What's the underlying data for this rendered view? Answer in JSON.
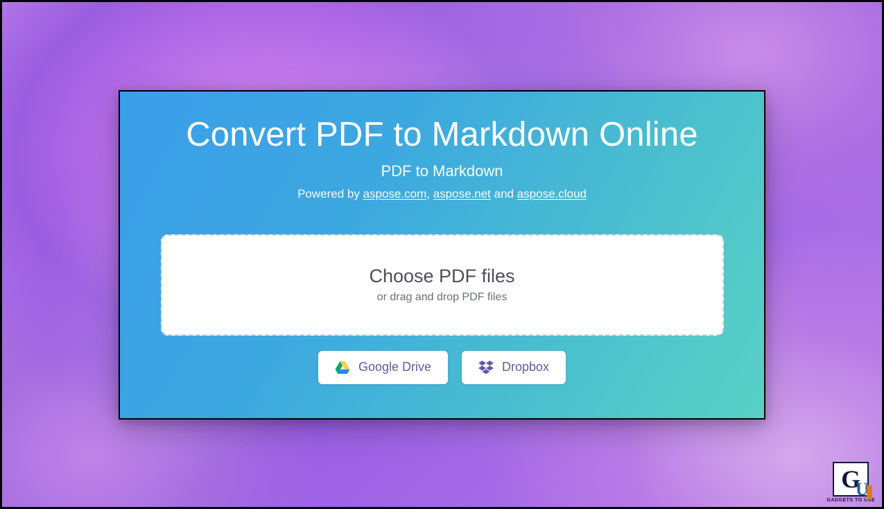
{
  "header": {
    "title": "Convert PDF to Markdown Online",
    "subtitle": "PDF to Markdown",
    "powered_prefix": "Powered by ",
    "links": {
      "aspose_com": "aspose.com",
      "aspose_net": "aspose.net",
      "aspose_cloud": "aspose.cloud"
    },
    "sep_comma": ", ",
    "sep_and": " and "
  },
  "dropzone": {
    "primary": "Choose PDF files",
    "secondary": "or drag and drop PDF files"
  },
  "cloud": {
    "gdrive_label": "Google Drive",
    "dropbox_label": "Dropbox"
  },
  "watermark": {
    "letter_g": "G",
    "letter_u": "U",
    "tagline": "GADGETS TO USE"
  }
}
